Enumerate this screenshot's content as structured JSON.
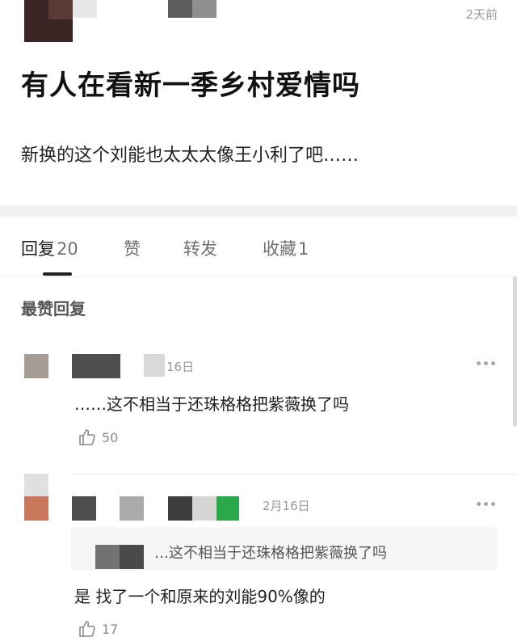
{
  "post": {
    "time": "2天前",
    "title": "有人在看新一季乡村爱情吗",
    "body": "新换的这个刘能也太太太像王小利了吧……"
  },
  "tabs": [
    {
      "label": "回复",
      "count": "20"
    },
    {
      "label": "赞",
      "count": ""
    },
    {
      "label": "转发",
      "count": ""
    },
    {
      "label": "收藏",
      "count": "1"
    }
  ],
  "section_label": "最赞回复",
  "comments": [
    {
      "date": "16日",
      "text": "……这不相当于还珠格格把紫薇换了吗",
      "likes": "50"
    },
    {
      "date": "2月16日",
      "quote": "…这不相当于还珠格格把紫薇换了吗",
      "text": "是 找了一个和原来的刘能90%像的",
      "likes": "17"
    }
  ],
  "colors": {
    "active_tab": "#1f1f1f",
    "muted": "#707070",
    "separator": "#f1f1f1",
    "green_badge": "#2aa84a"
  }
}
